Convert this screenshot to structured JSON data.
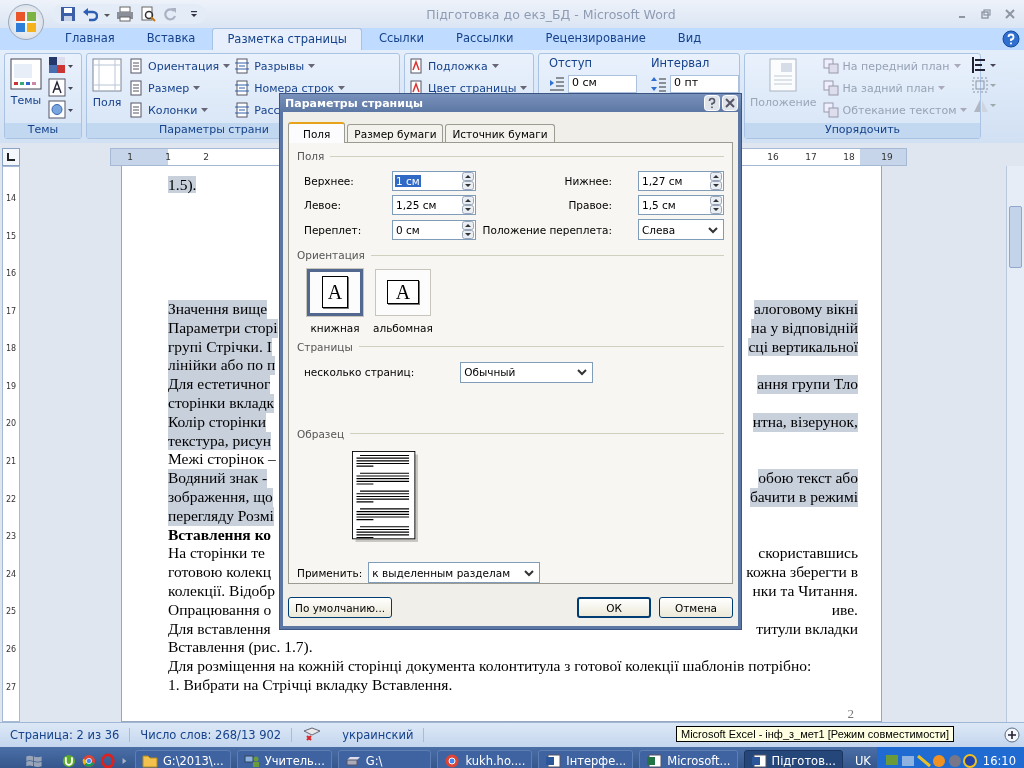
{
  "window": {
    "title": "Підготовка до екз_БД - Microsoft Word"
  },
  "tabs": [
    {
      "label": "Главная",
      "selected": false
    },
    {
      "label": "Вставка",
      "selected": false
    },
    {
      "label": "Разметка страницы",
      "selected": true
    },
    {
      "label": "Ссылки",
      "selected": false
    },
    {
      "label": "Рассылки",
      "selected": false
    },
    {
      "label": "Рецензирование",
      "selected": false
    },
    {
      "label": "Вид",
      "selected": false
    }
  ],
  "ribbon": {
    "themes": {
      "label": "Темы",
      "button": "Темы"
    },
    "page_setup": {
      "label": "Параметры страни",
      "margins_button": "Поля",
      "column_1": [
        "Ориентация",
        "Размер",
        "Колонки"
      ],
      "column_2": [
        "Разрывы",
        "Номера строк",
        "Расс"
      ]
    },
    "page_background": {
      "commands": [
        "Подложка",
        "Цвет страницы"
      ]
    },
    "paragraph": {
      "indent": {
        "label": "Отступ",
        "value": "0 см"
      },
      "spacing": {
        "label": "Интервал",
        "value": "0 пт"
      }
    },
    "arrange": {
      "label": "Упорядочить",
      "position": {
        "label": "Положение",
        "disabled": true
      },
      "commands": [
        {
          "label": "На передний план",
          "disabled": true
        },
        {
          "label": "На задний план",
          "disabled": true
        },
        {
          "label": "Обтекание текстом",
          "disabled": true
        }
      ]
    }
  },
  "ruler": {
    "left_numbers": [
      "1",
      "1",
      "2"
    ],
    "right_numbers": [
      "16",
      "17",
      "18",
      "19"
    ]
  },
  "vertical_ruler": {
    "numbers": [
      "14",
      "15",
      "16",
      "17",
      "18",
      "19",
      "20",
      "21",
      "22",
      "23",
      "24",
      "25",
      "26",
      "27"
    ]
  },
  "document": {
    "caption_line": {
      "text": "1.5).",
      "highlighted": true
    },
    "lines": [
      {
        "kind": "split",
        "left": "Значення вище",
        "right": "алоговому вікні",
        "highlighted": true,
        "bold": false
      },
      {
        "kind": "split",
        "left": "Параметри сторі",
        "right": "на у відповідній",
        "highlighted": true,
        "bold": false
      },
      {
        "kind": "split",
        "left": "групі Стрічки. І",
        "right": "сці вертикальної",
        "highlighted": true,
        "bold": false
      },
      {
        "kind": "split",
        "left": "лінійки або по п",
        "highlighted": true,
        "bold": false
      },
      {
        "kind": "split",
        "left": "Для естетичног",
        "right": "ання групи Тло",
        "highlighted": true,
        "bold": false
      },
      {
        "kind": "split",
        "left": "сторінки вкладк",
        "highlighted": true,
        "bold": false
      },
      {
        "kind": "split",
        "left": "Колір сторінки",
        "right": "нтна, візерунок,",
        "highlighted": true,
        "bold": false
      },
      {
        "kind": "split",
        "left": "текстура, рисун",
        "highlighted": true,
        "bold": false
      },
      {
        "kind": "split",
        "left": "Межі сторінок –",
        "highlighted": false,
        "bold": false
      },
      {
        "kind": "split",
        "left": "Водяний знак -",
        "right": "обою текст або",
        "highlighted": true,
        "bold": false
      },
      {
        "kind": "split",
        "left": "зображення, що",
        "right": "бачити в режимі",
        "highlighted": true,
        "bold": false
      },
      {
        "kind": "split",
        "left": "перегляду Розмі",
        "highlighted": true,
        "bold": false
      },
      {
        "kind": "split",
        "left": "Вставлення ко",
        "highlighted": false,
        "bold": true
      },
      {
        "kind": "split",
        "left": "На сторінки те",
        "right": "скориставшись",
        "highlighted": false,
        "bold": false
      },
      {
        "kind": "split",
        "left": "готовою колекц",
        "right": "кожна зберегти в",
        "highlighted": false,
        "bold": false
      },
      {
        "kind": "split",
        "left": "колекції. Відобр",
        "right": "нки та Читання.",
        "highlighted": false,
        "bold": false
      },
      {
        "kind": "split",
        "left": "Опрацювання о",
        "right": "иве.",
        "highlighted": false,
        "bold": false
      },
      {
        "kind": "split",
        "left": "Для вставлення",
        "right": "титули вкладки",
        "highlighted": false,
        "bold": false
      },
      {
        "kind": "full",
        "text": "Вставлення (рис. 1.7).",
        "highlighted": false,
        "bold": false
      },
      {
        "kind": "full",
        "text": "Для розміщення на кожній сторінці документа колонтитула з готової колекції шаблонів потрібно:",
        "highlighted": false,
        "bold": false
      },
      {
        "kind": "full",
        "text": "1. Вибрати на Стрічці вкладку Вставлення.",
        "highlighted": false,
        "bold": false
      }
    ],
    "page_number": "2"
  },
  "status_bar": {
    "page": "Страница: 2 из 36",
    "words": "Число слов: 268/13 902",
    "language": "украинский"
  },
  "taskbar": {
    "items": [
      {
        "label": "G:\\2013\\...",
        "kind": "folder",
        "selected": false
      },
      {
        "label": "Учитель...",
        "kind": "network",
        "selected": false
      },
      {
        "label": "G:\\",
        "kind": "drive",
        "selected": false
      },
      {
        "label": "kukh.ho....",
        "kind": "browser",
        "selected": false
      },
      {
        "label": "Інтерфе...",
        "kind": "word",
        "selected": false
      },
      {
        "label": "Microsoft...",
        "kind": "excel",
        "selected": false
      },
      {
        "label": "Підготов...",
        "kind": "word",
        "selected": true
      }
    ],
    "language": "UK",
    "clock": "16:10"
  },
  "tooltip": "Microsoft Excel - інф_з_мет1  [Режим совместимости]",
  "dialog": {
    "title": "Параметры страницы",
    "tabs": [
      {
        "label": "Поля",
        "selected": true
      },
      {
        "label": "Размер бумаги",
        "selected": false
      },
      {
        "label": "Источник бумаги",
        "selected": false
      }
    ],
    "margins_label": "Поля",
    "fields": [
      {
        "label": "Верхнее:",
        "value": "1 см",
        "kind": "spin",
        "selected": true
      },
      {
        "label": "Нижнее:",
        "value": "1,27 см",
        "kind": "spin",
        "selected": false
      },
      {
        "label": "Левое:",
        "value": "1,25 см",
        "kind": "spin",
        "selected": false
      },
      {
        "label": "Правое:",
        "value": "1,5 см",
        "kind": "spin",
        "selected": false
      },
      {
        "label": "Переплет:",
        "value": "0 см",
        "kind": "spin",
        "selected": false
      },
      {
        "label": "Положение переплета:",
        "value": "Слева",
        "kind": "select",
        "selected": false
      }
    ],
    "orientation": {
      "label": "Ориентация",
      "options": [
        {
          "label": "книжная",
          "glyph": "A",
          "kind": "portrait",
          "selected": true
        },
        {
          "label": "альбомная",
          "glyph": "A",
          "kind": "landscape",
          "selected": false
        }
      ]
    },
    "pages": {
      "label": "Страницы",
      "field_label": "несколько страниц:",
      "value": "Обычный"
    },
    "preview": {
      "label": "Образец"
    },
    "apply": {
      "label": "Применить:",
      "value": "к выделенным разделам"
    },
    "buttons": {
      "default": "По умолчанию...",
      "ok": "ОК",
      "cancel": "Отмена"
    }
  }
}
